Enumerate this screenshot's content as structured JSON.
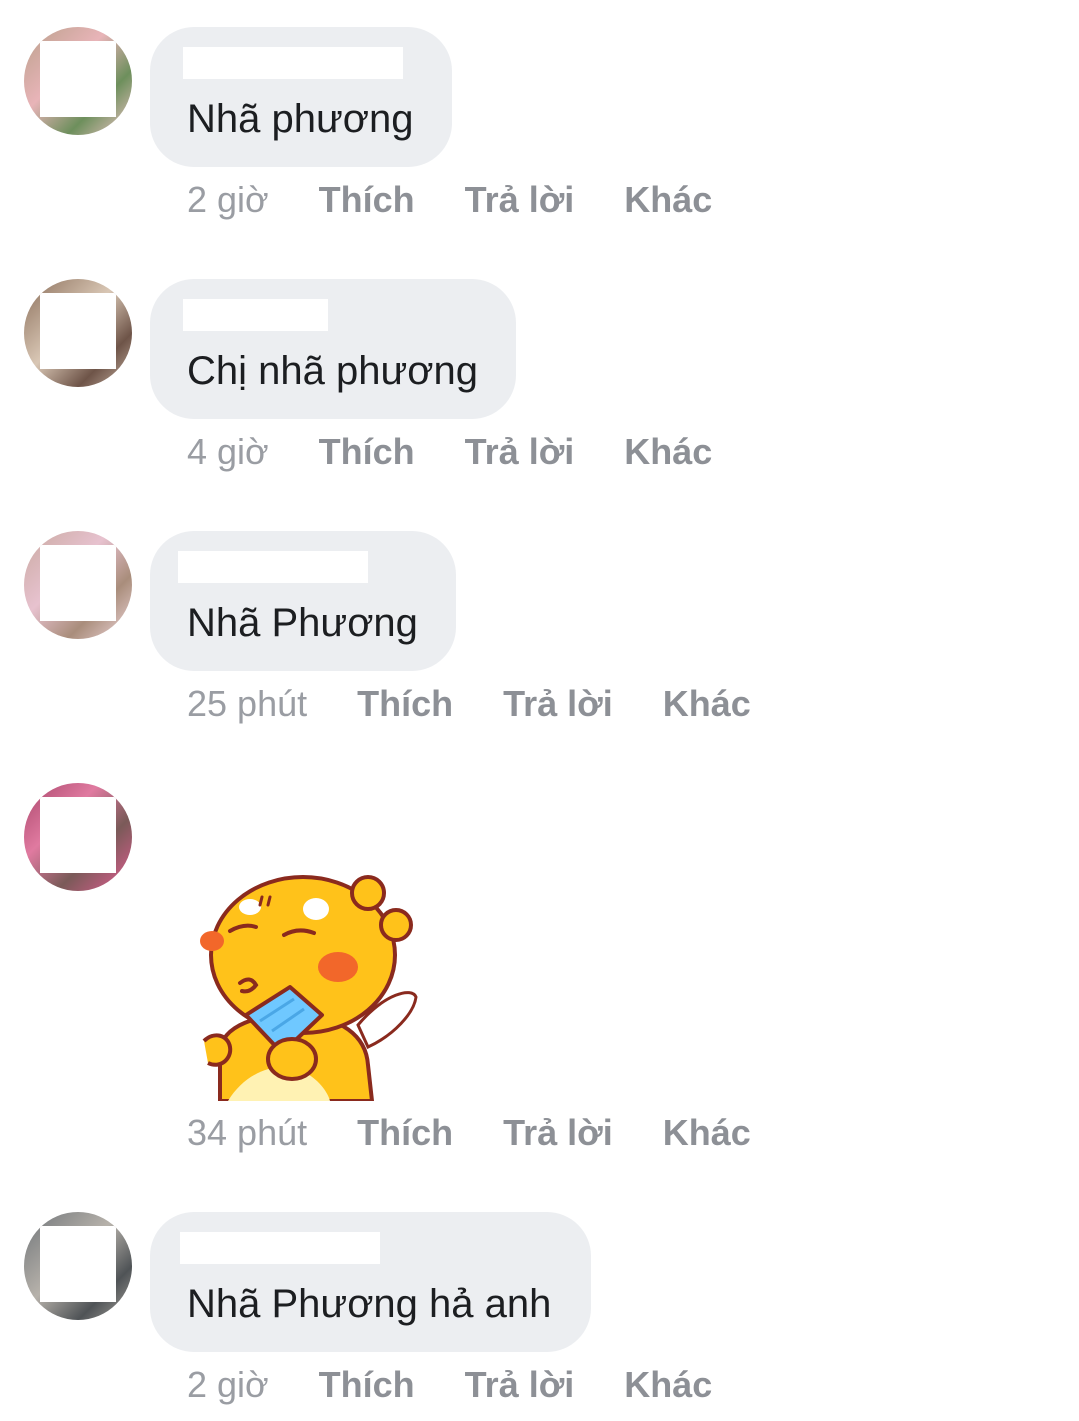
{
  "colors": {
    "bubble": "#eceef1",
    "text": "#1c1e21",
    "meta": "#8d9096"
  },
  "comments": [
    {
      "text": "Nhã phương",
      "time": "2 giờ",
      "like": "Thích",
      "reply": "Trả lời",
      "more": "Khác"
    },
    {
      "text": "Chị nhã phương",
      "time": "4 giờ",
      "like": "Thích",
      "reply": "Trả lời",
      "more": "Khác"
    },
    {
      "text": "Nhã Phương",
      "time": "25 phút",
      "like": "Thích",
      "reply": "Trả lời",
      "more": "Khác"
    },
    {
      "sticker": "yellow-chick-fan-sticker",
      "time": "34 phút",
      "like": "Thích",
      "reply": "Trả lời",
      "more": "Khác"
    },
    {
      "text": "Nhã Phương hả anh",
      "time": "2 giờ",
      "like": "Thích",
      "reply": "Trả lời",
      "more": "Khác"
    }
  ]
}
